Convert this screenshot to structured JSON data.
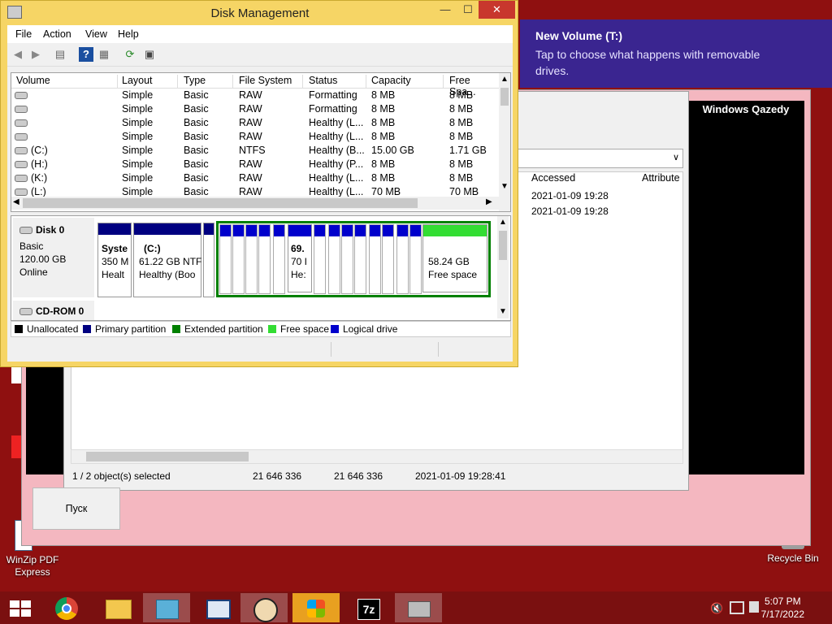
{
  "main_window": {
    "title": "Disk Management",
    "controls": {
      "minimize": "—",
      "maximize": "☐",
      "close": "✕"
    },
    "menu": [
      "File",
      "Action",
      "View",
      "Help"
    ],
    "columns": [
      "Volume",
      "Layout",
      "Type",
      "File System",
      "Status",
      "Capacity",
      "Free Spa..."
    ],
    "volumes": [
      {
        "volume": "",
        "layout": "Simple",
        "type": "Basic",
        "fs": "RAW",
        "status": "Formatting",
        "capacity": "8 MB",
        "free": "8 MB"
      },
      {
        "volume": "",
        "layout": "Simple",
        "type": "Basic",
        "fs": "RAW",
        "status": "Formatting",
        "capacity": "8 MB",
        "free": "8 MB"
      },
      {
        "volume": "",
        "layout": "Simple",
        "type": "Basic",
        "fs": "RAW",
        "status": "Healthy (L...",
        "capacity": "8 MB",
        "free": "8 MB"
      },
      {
        "volume": "",
        "layout": "Simple",
        "type": "Basic",
        "fs": "RAW",
        "status": "Healthy (L...",
        "capacity": "8 MB",
        "free": "8 MB"
      },
      {
        "volume": "(C:)",
        "layout": "Simple",
        "type": "Basic",
        "fs": "NTFS",
        "status": "Healthy (B...",
        "capacity": "15.00 GB",
        "free": "1.71 GB"
      },
      {
        "volume": "(H:)",
        "layout": "Simple",
        "type": "Basic",
        "fs": "RAW",
        "status": "Healthy (P...",
        "capacity": "8 MB",
        "free": "8 MB"
      },
      {
        "volume": "(K:)",
        "layout": "Simple",
        "type": "Basic",
        "fs": "RAW",
        "status": "Healthy (L...",
        "capacity": "8 MB",
        "free": "8 MB"
      },
      {
        "volume": "(L:)",
        "layout": "Simple",
        "type": "Basic",
        "fs": "RAW",
        "status": "Healthy (L...",
        "capacity": "70 MB",
        "free": "70 MB"
      }
    ],
    "disk0": {
      "name": "Disk 0",
      "type": "Basic",
      "size": "120.00 GB",
      "state": "Online"
    },
    "partitions": {
      "system": {
        "name": "Syste",
        "size": "350 M",
        "status": "Healt"
      },
      "c": {
        "name": "(C:)",
        "size": "61.22 GB NTF",
        "status": "Healthy (Boo"
      },
      "l": {
        "name": "69.",
        "size": "70 I",
        "status": "He:"
      },
      "free": {
        "size": "58.24 GB",
        "label": "Free space"
      }
    },
    "cdrom": "CD-ROM 0",
    "legend": [
      "Unallocated",
      "Primary partition",
      "Extended partition",
      "Free space",
      "Logical drive"
    ],
    "legend_colors": [
      "#000000",
      "#000080",
      "#008000",
      "#33dd33",
      "#0000cc"
    ]
  },
  "notification": {
    "title": "New Volume (T:)",
    "body": "Tap to choose what happens with removable drives."
  },
  "background_window": {
    "label": "Windows Qazedy",
    "columns": [
      "Accessed",
      "Attribute"
    ],
    "rows": [
      "2021-01-09 19:28",
      "2021-01-09 19:28"
    ],
    "status": {
      "selected": "1 / 2 object(s) selected",
      "size1": "21 646 336",
      "size2": "21 646 336",
      "date": "2021-01-09 19:28:41"
    },
    "button": "Пуск"
  },
  "desktop_icons": {
    "winzip": "WinZip PDF Express",
    "recycle": "Recycle Bin"
  },
  "clock": {
    "time": "5:07 PM",
    "date": "7/17/2022"
  }
}
